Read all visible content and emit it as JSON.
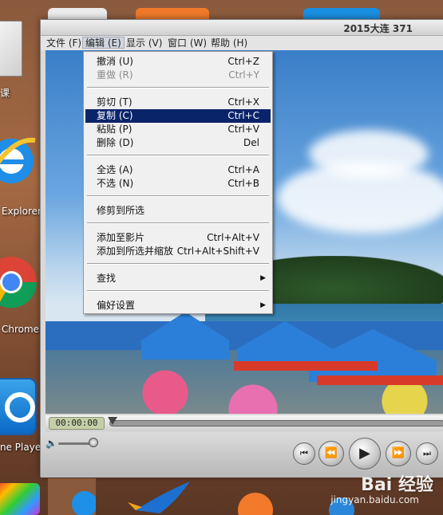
{
  "desktop": {
    "icons": [
      {
        "name": "doc",
        "label": "课"
      },
      {
        "name": "ie",
        "label": "Explorer"
      },
      {
        "name": "chrome",
        "label": "Chrome"
      },
      {
        "name": "quicktime",
        "label": "ne Player"
      }
    ]
  },
  "window": {
    "title": "2015大连 371"
  },
  "menubar": {
    "items": [
      {
        "label": "文件 (F)"
      },
      {
        "label": "编辑 (E)"
      },
      {
        "label": "显示 (V)"
      },
      {
        "label": "窗口 (W)"
      },
      {
        "label": "帮助 (H)"
      }
    ]
  },
  "edit_menu": {
    "groups": [
      [
        {
          "label": "撤消 (U)",
          "shortcut": "Ctrl+Z",
          "disabled": false
        },
        {
          "label": "重做 (R)",
          "shortcut": "Ctrl+Y",
          "disabled": true
        }
      ],
      [
        {
          "label": "剪切 (T)",
          "shortcut": "Ctrl+X"
        },
        {
          "label": "复制 (C)",
          "shortcut": "Ctrl+C",
          "highlight": true
        },
        {
          "label": "粘贴 (P)",
          "shortcut": "Ctrl+V"
        },
        {
          "label": "删除 (D)",
          "shortcut": "Del"
        }
      ],
      [
        {
          "label": "全选 (A)",
          "shortcut": "Ctrl+A"
        },
        {
          "label": "不选 (N)",
          "shortcut": "Ctrl+B"
        }
      ],
      [
        {
          "label": "修剪到所选",
          "shortcut": ""
        }
      ],
      [
        {
          "label": "添加至影片",
          "shortcut": "Ctrl+Alt+V"
        },
        {
          "label": "添加到所选并缩放",
          "shortcut": "Ctrl+Alt+Shift+V"
        }
      ],
      [
        {
          "label": "查找",
          "shortcut": "",
          "submenu": true
        }
      ],
      [
        {
          "label": "偏好设置",
          "shortcut": "",
          "submenu": true
        }
      ]
    ]
  },
  "player": {
    "time": "00:00:00",
    "volume_level": 0.85,
    "progress": 0.0
  },
  "watermark": {
    "brand": "Bai 经验",
    "sub": "jingyan.baidu.com"
  }
}
